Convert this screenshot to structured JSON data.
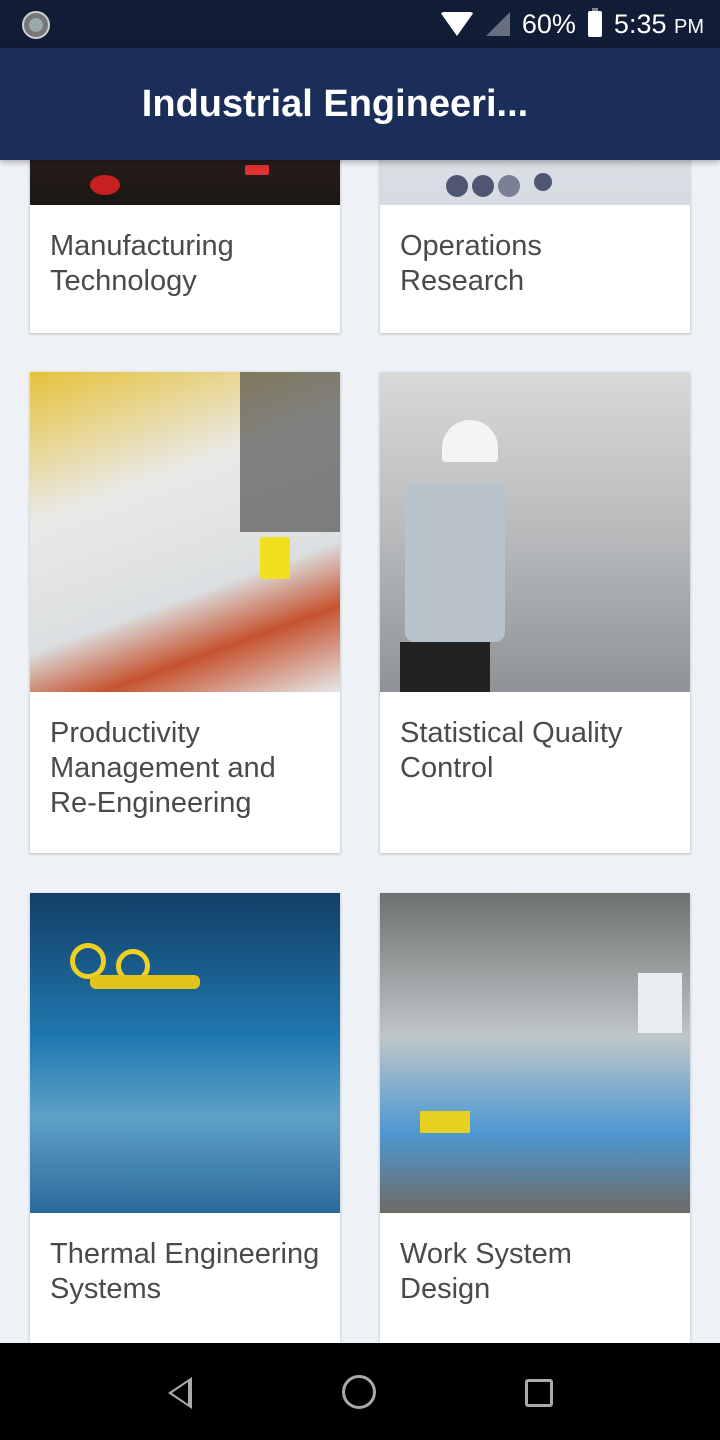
{
  "status_bar": {
    "battery_percent": "60%",
    "time": "5:35",
    "ampm": "PM",
    "icons": [
      "sync-icon",
      "wifi-icon",
      "cell-signal-icon",
      "battery-charging-icon"
    ]
  },
  "app_bar": {
    "title": "Industrial Engineeri..."
  },
  "cards": [
    {
      "label": "Manufacturing Technology",
      "image": "manufacturing-technology-image"
    },
    {
      "label": "Operations Research",
      "image": "operations-research-image"
    },
    {
      "label": "Productivity Management and Re-Engineering",
      "image": "productivity-management-image"
    },
    {
      "label": "Statistical Quality Control",
      "image": "statistical-quality-control-image"
    },
    {
      "label": "Thermal Engineering Systems",
      "image": "thermal-engineering-image"
    },
    {
      "label": "Work System Design",
      "image": "work-system-design-image"
    }
  ],
  "nav_bar": {
    "buttons": [
      "back",
      "home",
      "recents"
    ]
  }
}
